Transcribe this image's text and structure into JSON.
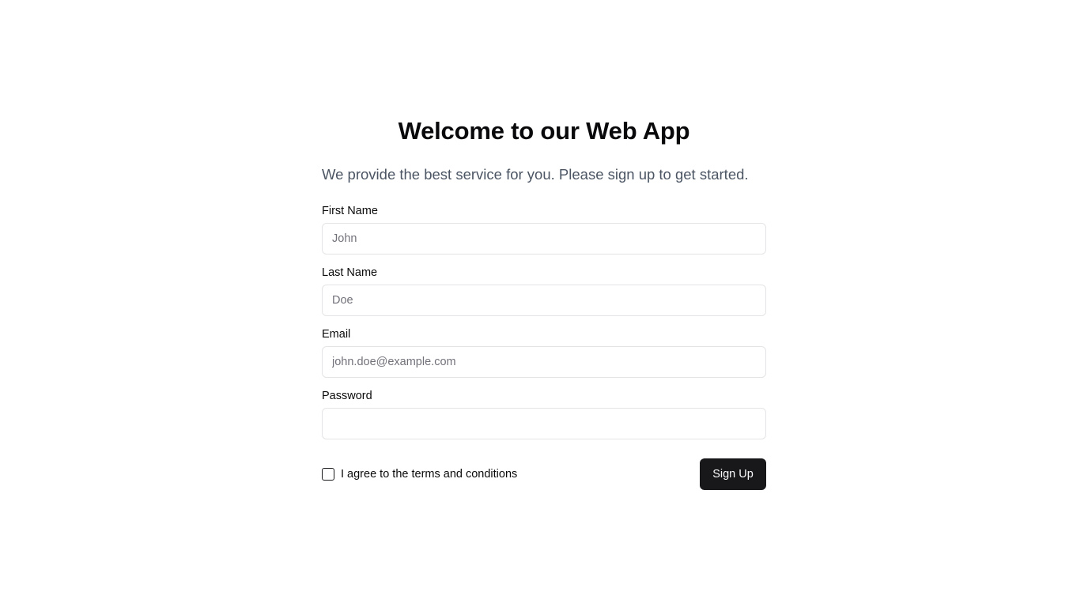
{
  "header": {
    "title": "Welcome to our Web App",
    "subtitle": "We provide the best service for you. Please sign up to get started."
  },
  "form": {
    "first_name": {
      "label": "First Name",
      "placeholder": "John",
      "value": ""
    },
    "last_name": {
      "label": "Last Name",
      "placeholder": "Doe",
      "value": ""
    },
    "email": {
      "label": "Email",
      "placeholder": "john.doe@example.com",
      "value": ""
    },
    "password": {
      "label": "Password",
      "placeholder": "",
      "value": ""
    },
    "terms": {
      "label": "I agree to the terms and conditions",
      "checked": false
    },
    "submit_label": "Sign Up"
  },
  "colors": {
    "primary_button": "#18181b",
    "subtitle_text": "#4b5563",
    "input_border": "#e4e4e7",
    "placeholder": "#71717a"
  }
}
